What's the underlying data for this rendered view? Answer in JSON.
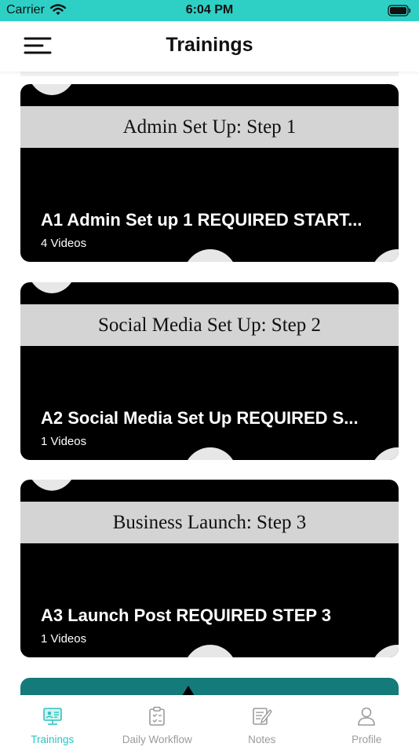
{
  "status_bar": {
    "carrier": "Carrier",
    "time": "6:04 PM",
    "icons": [
      "wifi-icon",
      "battery-icon"
    ]
  },
  "nav": {
    "title": "Trainings",
    "menu_icon": "menu-icon"
  },
  "trainings": [
    {
      "banner": "Admin Set Up:  Step 1",
      "title": "A1 Admin Set up 1 REQUIRED START...",
      "videos": "4 Videos"
    },
    {
      "banner": "Social Media Set Up:  Step 2",
      "title": "A2 Social Media Set Up REQUIRED S...",
      "videos": "1 Videos"
    },
    {
      "banner": "Business Launch:  Step 3",
      "title": "A3 Launch Post REQUIRED STEP 3",
      "videos": "1 Videos"
    }
  ],
  "tabs": [
    {
      "label": "Trainings",
      "icon": "trainings-icon",
      "active": true
    },
    {
      "label": "Daily Workflow",
      "icon": "clipboard-icon",
      "active": false
    },
    {
      "label": "Notes",
      "icon": "notes-icon",
      "active": false
    },
    {
      "label": "Profile",
      "icon": "profile-icon",
      "active": false
    }
  ],
  "colors": {
    "status_bar_bg": "#2ed0c6",
    "active_tab": "#2ec4c0",
    "inactive_tab": "#9b9b9b",
    "card_bg": "#000000",
    "card_band": "#d4d4d4",
    "next_card_bg": "#147a7a"
  }
}
